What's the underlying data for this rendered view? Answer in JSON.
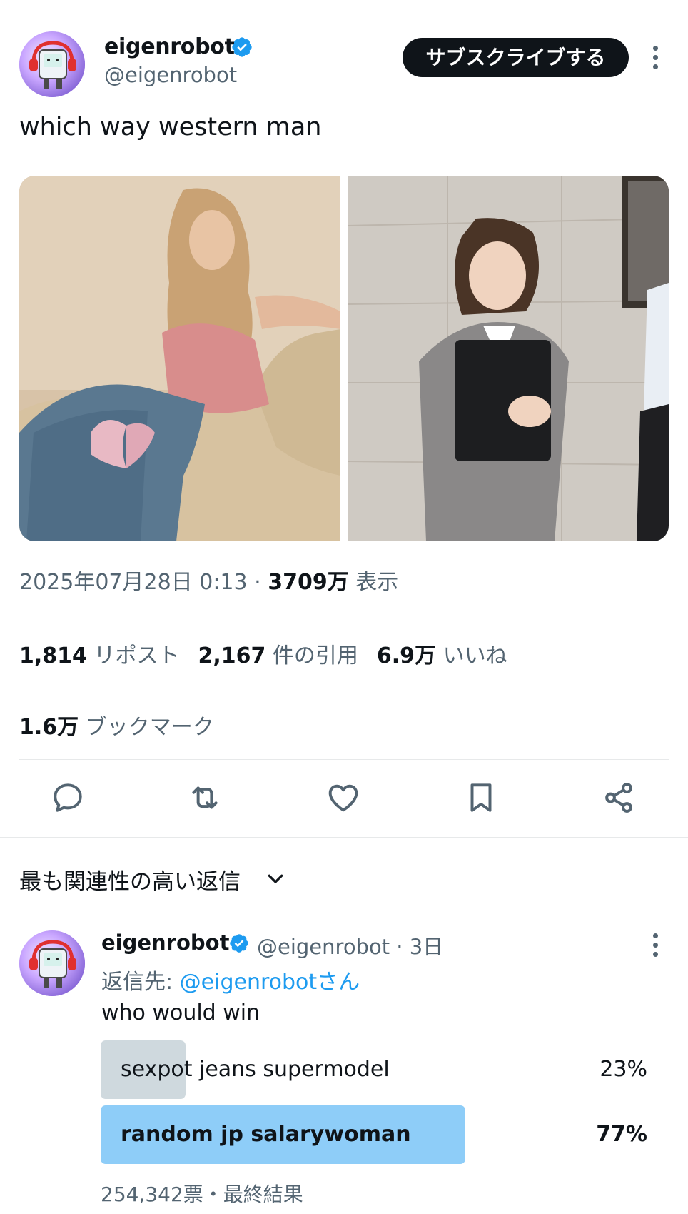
{
  "tweet": {
    "author_name": "eigenrobot",
    "author_handle": "@eigenrobot",
    "subscribe_label": "サブスクライブする",
    "text": "which way western man",
    "timestamp": "2025年07月28日 0:13",
    "separator": " · ",
    "views_count": "3709万",
    "views_label": " 表示",
    "stats": {
      "reposts_count": "1,814",
      "reposts_label": "リポスト",
      "quotes_count": "2,167",
      "quotes_label": "件の引用",
      "likes_count": "6.9万",
      "likes_label": "いいね",
      "bookmarks_count": "1.6万",
      "bookmarks_label": "ブックマーク"
    },
    "actions": [
      "reply-icon",
      "repost-icon",
      "like-icon",
      "bookmark-icon",
      "share-icon"
    ]
  },
  "replies_sort": {
    "label": "最も関連性の高い返信"
  },
  "reply": {
    "author_name": "eigenrobot",
    "meta": "@eigenrobot · 3日",
    "reply_to_prefix": "返信先: ",
    "reply_to_handle": "@eigenrobotさん",
    "text": "who would win",
    "poll": {
      "options": [
        {
          "label": "sexpot jeans supermodel",
          "percent": "23%",
          "fraction": 0.23,
          "winner": false
        },
        {
          "label": "random jp salarywoman",
          "percent": "77%",
          "fraction": 0.77,
          "winner": true
        }
      ],
      "footer": "254,342票・最終結果"
    }
  },
  "colors": {
    "accent": "#1d9bf0",
    "text_primary": "#0f1419",
    "text_secondary": "#536471",
    "poll_winner_fill": "#8ecdf8",
    "poll_loser_fill": "#cfd9de",
    "verified_badge": "#1d9bf0"
  }
}
